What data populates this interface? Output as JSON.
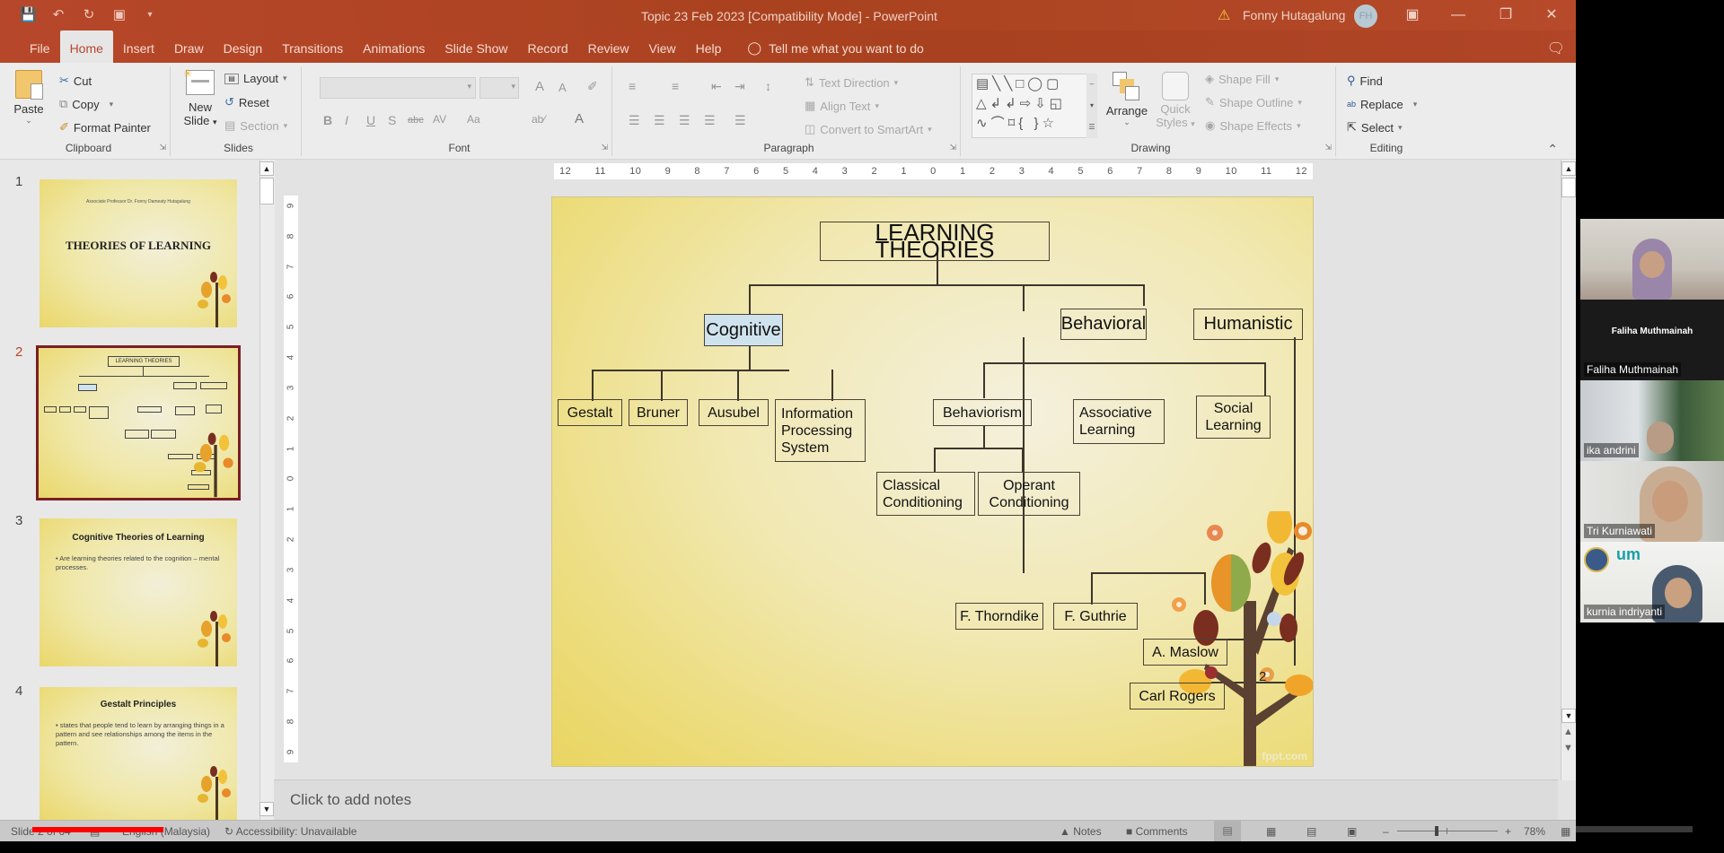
{
  "window": {
    "doc_title": "Topic 23 Feb 2023 [Compatibility Mode]  -  PowerPoint",
    "user_name": "Fonny Hutagalung",
    "user_initials": "FH",
    "accent": "#b7472a"
  },
  "qat": {
    "save": "save-icon",
    "undo": "undo-icon",
    "redo": "redo-icon",
    "present": "present-from-start-icon",
    "customize": "customize-qat-icon"
  },
  "tabs": [
    "File",
    "Home",
    "Insert",
    "Draw",
    "Design",
    "Transitions",
    "Animations",
    "Slide Show",
    "Record",
    "Review",
    "View",
    "Help"
  ],
  "active_tab": "Home",
  "tell_me": "Tell me what you want to do",
  "ribbon": {
    "clipboard": {
      "label": "Clipboard",
      "paste": "Paste",
      "cut": "Cut",
      "copy": "Copy",
      "format_painter": "Format Painter"
    },
    "slides": {
      "label": "Slides",
      "new_slide_line1": "New",
      "new_slide_line2": "Slide",
      "layout": "Layout",
      "reset": "Reset",
      "section": "Section"
    },
    "font": {
      "label": "Font",
      "font_name": "",
      "font_size": "",
      "bold": "B",
      "italic": "I",
      "underline": "U",
      "shadow": "S",
      "strike": "abc",
      "spacing": "AV",
      "case": "Aa",
      "grow": "A",
      "shrink": "A",
      "color": "A"
    },
    "paragraph": {
      "label": "Paragraph",
      "text_direction": "Text Direction",
      "align_text": "Align Text",
      "convert_smartart": "Convert to SmartArt"
    },
    "drawing": {
      "label": "Drawing",
      "arrange": "Arrange",
      "quick_styles_1": "Quick",
      "quick_styles_2": "Styles",
      "shape_fill": "Shape Fill",
      "shape_outline": "Shape Outline",
      "shape_effects": "Shape Effects"
    },
    "editing": {
      "label": "Editing",
      "find": "Find",
      "replace": "Replace",
      "select": "Select"
    }
  },
  "thumbnails": [
    {
      "num": "1",
      "title": "THEORIES OF LEARNING",
      "subtitle": "Associate Professor Dr. Fonny Dameaty Hutagalung",
      "body": ""
    },
    {
      "num": "2",
      "title": "LEARNING THEORIES",
      "subtitle": "",
      "body": ""
    },
    {
      "num": "3",
      "title": "Cognitive Theories of Learning",
      "subtitle": "",
      "body": "•  Are learning theories related to the cognition – mental processes."
    },
    {
      "num": "4",
      "title": "Gestalt Principles",
      "subtitle": "",
      "body": "•  states that people tend to learn by arranging things in a pattern and see relationships among the items in the pattern."
    }
  ],
  "selected_slide": "2",
  "rulers": {
    "horizontal": [
      "12",
      "11",
      "10",
      "9",
      "8",
      "7",
      "6",
      "5",
      "4",
      "3",
      "2",
      "1",
      "0",
      "1",
      "2",
      "3",
      "4",
      "5",
      "6",
      "7",
      "8",
      "9",
      "10",
      "11",
      "12"
    ],
    "vertical": [
      "9",
      "8",
      "7",
      "6",
      "5",
      "4",
      "3",
      "2",
      "1",
      "0",
      "1",
      "2",
      "3",
      "4",
      "5",
      "6",
      "7",
      "8",
      "9"
    ]
  },
  "slide": {
    "title": "LEARNING THEORIES",
    "categories": {
      "cognitive": "Cognitive",
      "behavioral": "Behavioral",
      "humanistic": "Humanistic"
    },
    "cognitive_children": [
      "Gestalt",
      "Bruner",
      "Ausubel",
      "Information\nProcessing\nSystem"
    ],
    "behavioral_children": {
      "behaviorism": "Behaviorism",
      "associative": "Associative\nLearning",
      "social": "Social\nLearning"
    },
    "behaviorism_children": [
      "Classical\nConditioning",
      "Operant\nConditioning"
    ],
    "associative_children": [
      "F. Thorndike",
      "F. Guthrie"
    ],
    "humanistic_children": [
      "A. Maslow",
      "Carl Rogers"
    ],
    "page_number": "2",
    "watermark": "fppt.com",
    "cognitive_fill": "#cfe3ee"
  },
  "notes_placeholder": "Click to add notes",
  "status": {
    "slide_info": "Slide 2 of 64",
    "language": "English (Malaysia)",
    "accessibility": "Accessibility: Unavailable",
    "notes": "Notes",
    "comments": "Comments",
    "zoom": "78%"
  },
  "participants": [
    {
      "name": "Faliha Muthmainah",
      "video": true
    },
    {
      "name": "Faliha Muthmainah",
      "video": false
    },
    {
      "name": "ika andrini",
      "video": true
    },
    {
      "name": "Tri Kurniawati",
      "video": true
    },
    {
      "name": "kurnia indriyanti",
      "video": true
    }
  ]
}
